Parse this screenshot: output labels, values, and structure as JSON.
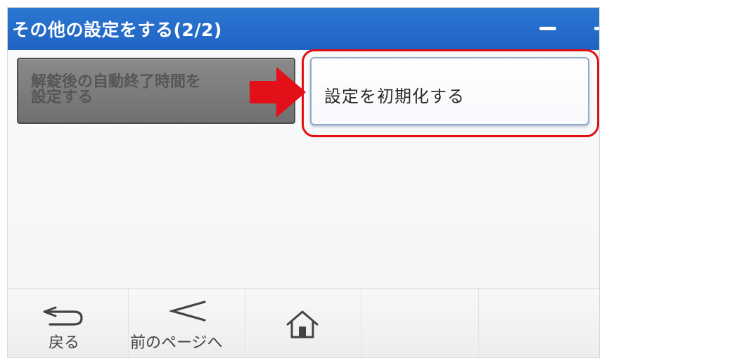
{
  "window": {
    "title": "その他の設定をする(2/2)"
  },
  "buttons": {
    "auto_end_time": "解錠後の自動終了時間を\n設定する",
    "reset_settings": "設定を初期化する"
  },
  "nav": {
    "back_label": "戻る",
    "prev_page_label": "前のページへ",
    "home_icon": "home-icon",
    "back_icon": "back-arrow-icon",
    "prev_icon": "chevron-left-icon"
  },
  "colors": {
    "titlebar": "#2c76d2",
    "highlight": "#e10e12",
    "arrow": "#e3101a",
    "disabled_button": "#7c7c7c"
  }
}
